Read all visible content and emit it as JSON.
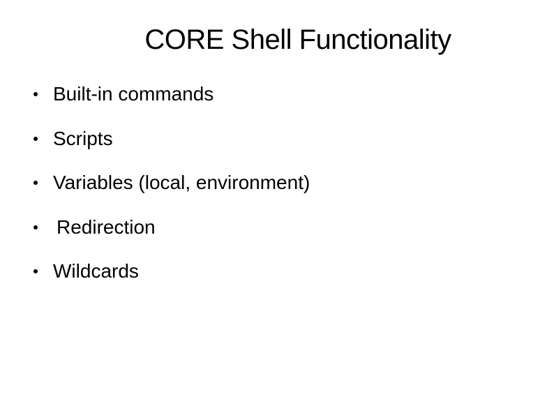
{
  "slide": {
    "title": "CORE Shell Functionality",
    "bullets": [
      "Built-in commands",
      "Scripts",
      "Variables (local, environment)",
      "Redirection",
      "Wildcards"
    ]
  }
}
